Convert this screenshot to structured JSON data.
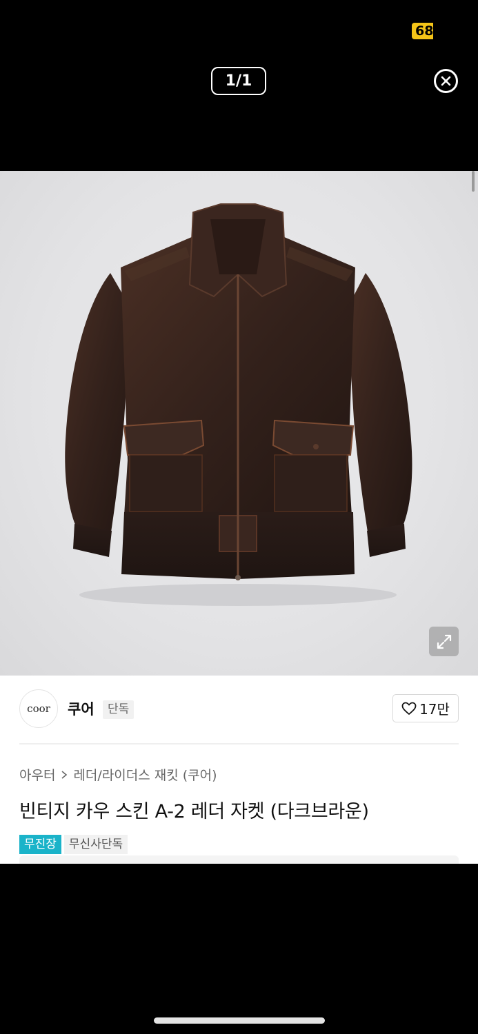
{
  "status": {
    "badge_text": "68"
  },
  "viewer": {
    "counter": "1/1",
    "close_icon": "close-circle-icon",
    "expand_icon": "expand-icon"
  },
  "brand": {
    "logo_text": "coor",
    "name": "쿠어",
    "tag": "단독",
    "likes": "17만"
  },
  "breadcrumb": {
    "category": "아우터",
    "subcategory": "레더/라이더스 재킷 (쿠어)"
  },
  "product": {
    "title": "빈티지 카우 스킨 A-2 레더 자켓 (다크브라운)",
    "badges": [
      "무진장",
      "무신사단독"
    ]
  },
  "colors": {
    "accent": "#1ab3c9",
    "status_badge": "#f5c518"
  }
}
